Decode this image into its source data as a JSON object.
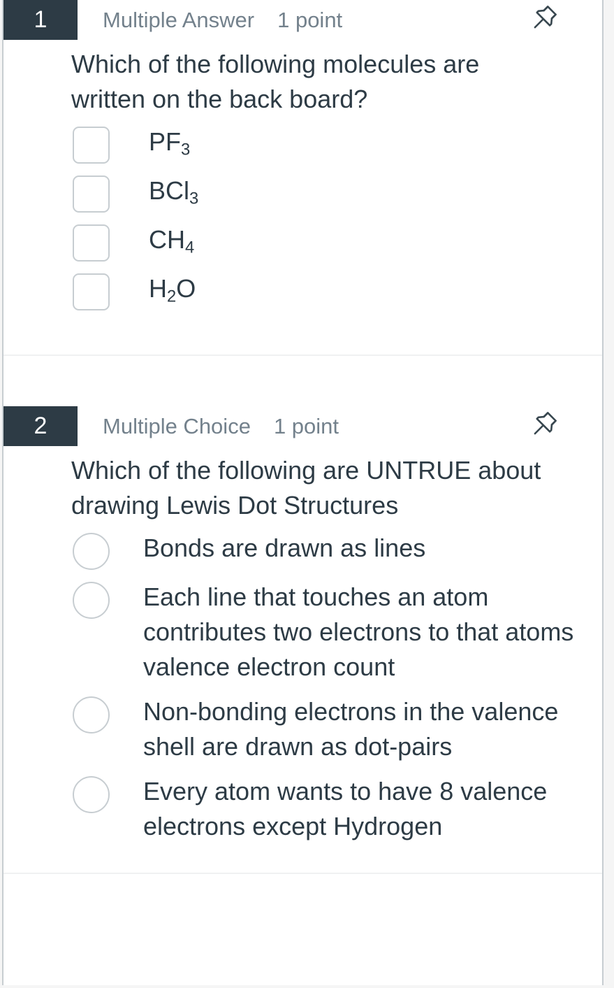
{
  "quiz": {
    "questions": [
      {
        "number": "1",
        "type": "Multiple Answer",
        "points": "1 point",
        "pin_icon": "pushpin-icon",
        "control_type": "checkbox",
        "text": "Which of the following molecules are written on the back board?",
        "options": [
          {
            "base": "PF",
            "sub": "3",
            "tail": ""
          },
          {
            "base": "BCl",
            "sub": "3",
            "tail": ""
          },
          {
            "base": "CH",
            "sub": "4",
            "tail": ""
          },
          {
            "base": "H",
            "sub": "2",
            "tail": "O"
          }
        ]
      },
      {
        "number": "2",
        "type": "Multiple Choice",
        "points": "1 point",
        "pin_icon": "pushpin-icon",
        "control_type": "radio",
        "text": "Which of the following are UNTRUE about drawing Lewis Dot Structures",
        "options": [
          {
            "base": "Bonds are drawn as lines",
            "sub": "",
            "tail": ""
          },
          {
            "base": "Each line that touches an atom contributes two electrons to that atoms valence electron count",
            "sub": "",
            "tail": ""
          },
          {
            "base": "Non-bonding electrons in the valence shell are drawn as dot-pairs",
            "sub": "",
            "tail": ""
          },
          {
            "base": "Every atom wants to have 8 valence electrons except Hydrogen",
            "sub": "",
            "tail": ""
          }
        ]
      }
    ]
  },
  "colors": {
    "badge_background": "#2d3b45",
    "badge_text": "#ffffff",
    "meta_text": "#73818c",
    "body_text": "#2d3b45",
    "control_border": "#c7cdd1",
    "divider": "#f0f1f2",
    "page_background": "#f5f5f5"
  }
}
